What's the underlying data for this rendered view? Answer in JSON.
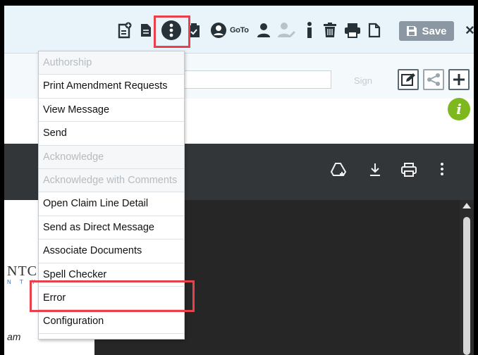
{
  "toolbar": {
    "goto_label": "GoTo",
    "save_label": "Save",
    "close_label": "×"
  },
  "row2": {
    "sign_label": "Sign"
  },
  "info_badge": "i",
  "menu": {
    "items": [
      {
        "label": "Authorship",
        "enabled": false
      },
      {
        "label": "Print Amendment Requests",
        "enabled": true
      },
      {
        "label": "View Message",
        "enabled": true
      },
      {
        "label": "Send",
        "enabled": true
      },
      {
        "label": "Acknowledge",
        "enabled": false
      },
      {
        "label": "Acknowledge with Comments",
        "enabled": false
      },
      {
        "label": "Open Claim Line Detail",
        "enabled": true
      },
      {
        "label": "Send as Direct Message",
        "enabled": true
      },
      {
        "label": "Associate Documents",
        "enabled": true
      },
      {
        "label": "Spell Checker",
        "enabled": true
      },
      {
        "label": "Error",
        "enabled": true
      },
      {
        "label": "Configuration",
        "enabled": true
      }
    ]
  },
  "document": {
    "logo_text": "NTC",
    "logo_sub": "N T Y",
    "fragment_word": "am"
  },
  "colors": {
    "highlight": "#e8414b",
    "info_green": "#7cb81e",
    "save_gray": "#8b98a4"
  }
}
